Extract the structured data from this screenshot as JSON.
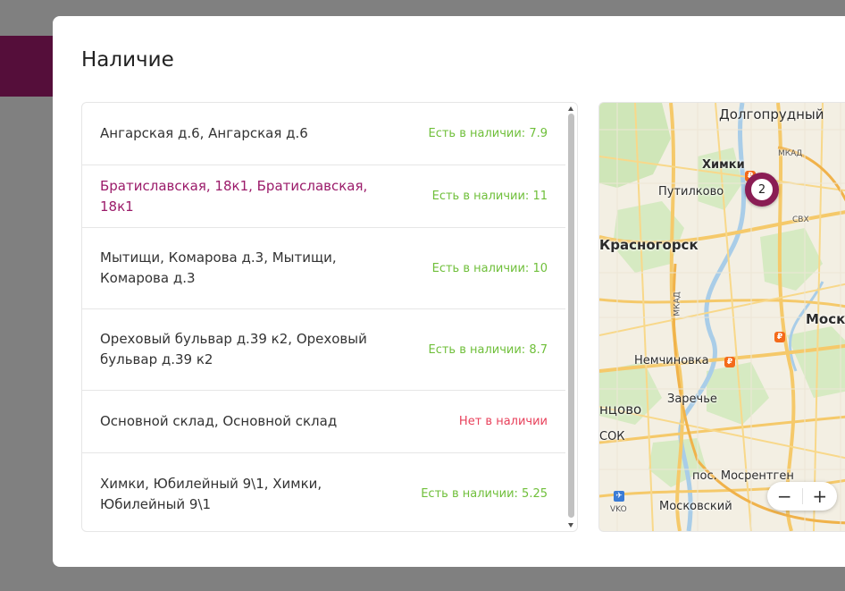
{
  "modal": {
    "title": "Наличие"
  },
  "stores": [
    {
      "name": "Ангарская д.6, Ангарская д.6",
      "status": "Есть в наличии: 7.9",
      "in_stock": true
    },
    {
      "name": "Братиславская, 18к1, Братиславская, 18к1",
      "status": "Есть в наличии: 11",
      "in_stock": true,
      "selected": true
    },
    {
      "name": "Мытищи, Комарова д.3, Мытищи, Комарова д.3",
      "status": "Есть в наличии: 10",
      "in_stock": true
    },
    {
      "name": "Ореховый бульвар д.39 к2, Ореховый бульвар д.39 к2",
      "status": "Есть в наличии: 8.7",
      "in_stock": true
    },
    {
      "name": "Основной склад, Основной склад",
      "status": "Нет в наличии",
      "in_stock": false
    },
    {
      "name": "Химки, Юбилейный 9\\1, Химки, Юбилейный 9\\1",
      "status": "Есть в наличии: 5.25",
      "in_stock": true
    }
  ],
  "map": {
    "labels": {
      "dolgoprudny": "Долгопрудный",
      "mkad1": "МКАД",
      "khimki": "Химки",
      "putilkovo": "Путилково",
      "svkh": "СВХ",
      "krasnogorsk": "Красногорск",
      "mkad2": "МКАД",
      "moscow": "Моск",
      "nemchinovka": "Немчиновка",
      "zarechye": "Заречье",
      "intsovo": "нцово",
      "sok": "СОК",
      "mosrentgen": "пос. Мосрентген",
      "vko": "VKO",
      "moskovsky": "Московский"
    },
    "cluster_count": "2",
    "zoom_out_label": "−",
    "zoom_in_label": "+",
    "fuel_glyph": "₽",
    "plane_glyph": "✈"
  },
  "colors": {
    "accent": "#9b1b6a",
    "in_stock": "#6fbf3a",
    "out_of_stock": "#e8415b",
    "cluster_ring": "#8a1d54"
  }
}
